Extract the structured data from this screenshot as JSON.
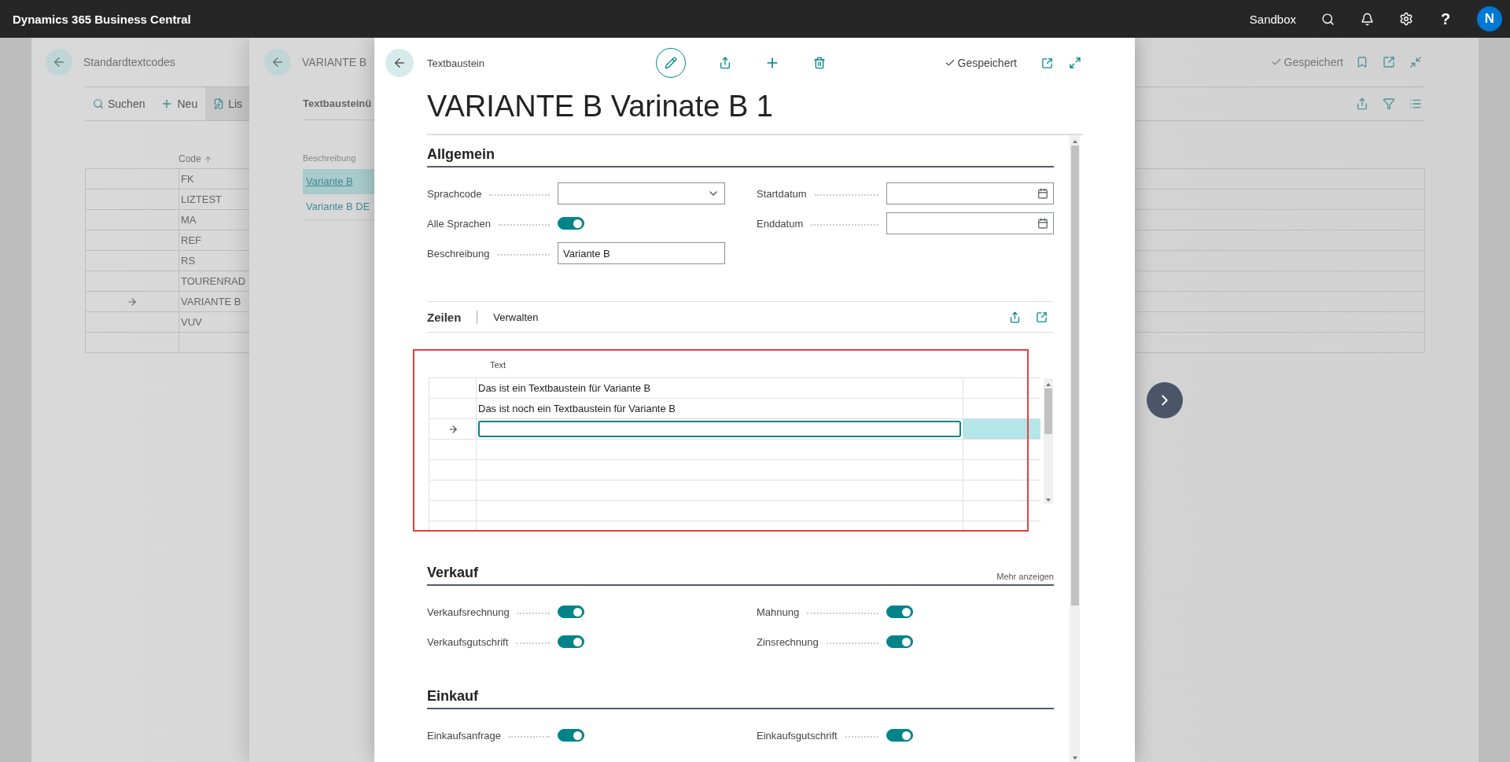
{
  "top_bar": {
    "app_name": "Dynamics 365 Business Central",
    "environment": "Sandbox",
    "help": "?",
    "avatar": "N"
  },
  "list_page": {
    "title": "Standardtextcodes",
    "status": "Gespeichert",
    "actions": [
      {
        "kind": "search",
        "label": "Suchen"
      },
      {
        "kind": "new",
        "label": "Neu"
      },
      {
        "kind": "edit",
        "label": "Lis"
      }
    ],
    "column": "Code",
    "rows": [
      {
        "code": "FK",
        "current": false
      },
      {
        "code": "LIZTEST",
        "current": false
      },
      {
        "code": "MA",
        "current": false
      },
      {
        "code": "REF",
        "current": false
      },
      {
        "code": "RS",
        "current": false
      },
      {
        "code": "TOURENRAD",
        "current": false
      },
      {
        "code": "VARIANTE B",
        "current": true
      },
      {
        "code": "VUV",
        "current": false
      }
    ]
  },
  "sub_page": {
    "title": "VARIANTE B",
    "tab": "Textbausteinü",
    "column": "Beschreibung",
    "rows": [
      {
        "text": "Variante B",
        "selected": true
      },
      {
        "text": "Variante B DE",
        "selected": false
      }
    ]
  },
  "dialog": {
    "caption": "Textbaustein",
    "status": "Gespeichert",
    "title": "VARIANTE B Varinate B 1",
    "general": {
      "heading": "Allgemein",
      "columns": [
        [
          {
            "label": "Sprachcode",
            "kind": "dropdown"
          },
          {
            "label": "Alle Sprachen",
            "kind": "toggle",
            "on": true
          },
          {
            "label": "Beschreibung",
            "kind": "text",
            "value": "Variante B"
          }
        ],
        [
          {
            "label": "Startdatum",
            "kind": "date"
          },
          {
            "label": "Enddatum",
            "kind": "date"
          }
        ]
      ]
    },
    "lines": {
      "heading": "Zeilen",
      "action": "Verwalten",
      "column": "Text",
      "highlighted": true,
      "rows": [
        {
          "text": "Das ist ein Textbaustein für Variante B",
          "current": false
        },
        {
          "text": "Das ist noch ein Textbaustein für Variante B",
          "current": false
        },
        {
          "current": true
        }
      ]
    },
    "sales": {
      "heading": "Verkauf",
      "more": "Mehr anzeigen",
      "columns": [
        [
          {
            "label": "Verkaufsrechnung",
            "kind": "toggle",
            "on": true
          },
          {
            "label": "Verkaufsgutschrift",
            "kind": "toggle",
            "on": true
          }
        ],
        [
          {
            "label": "Mahnung",
            "kind": "toggle",
            "on": true
          },
          {
            "label": "Zinsrechnung",
            "kind": "toggle",
            "on": true
          }
        ]
      ]
    },
    "purchase": {
      "heading": "Einkauf",
      "columns": [
        [
          {
            "label": "Einkaufsanfrage",
            "kind": "toggle",
            "on": true
          }
        ],
        [
          {
            "label": "Einkaufsgutschrift",
            "kind": "toggle",
            "on": true
          }
        ]
      ]
    }
  }
}
